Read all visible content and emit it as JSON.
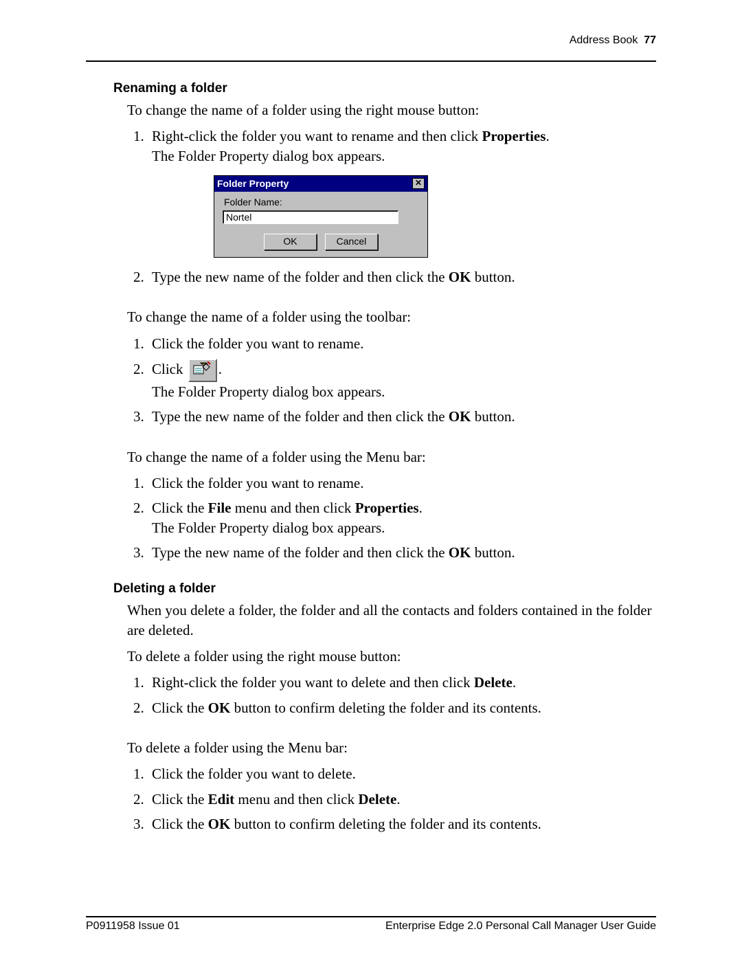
{
  "header": {
    "section": "Address Book",
    "page_no": "77"
  },
  "s1": {
    "heading": "Renaming a folder",
    "intro_rc": "To change the name of a folder using the right mouse button:",
    "rc_step1_pre": "Right-click the folder you want to rename and then click ",
    "rc_step1_bold": "Properties",
    "rc_step1_post": ".",
    "rc_step1_line2": "The Folder Property dialog box appears.",
    "rc_step2_pre": "Type the new name of the folder and then click the ",
    "rc_step2_bold": "OK",
    "rc_step2_post": " button.",
    "intro_tb": "To change the name of a folder using the toolbar:",
    "tb_step1": "Click the folder you want to rename.",
    "tb_step2_pre": "Click ",
    "tb_step2_post": ".",
    "tb_step2_line2": "The Folder Property dialog box appears.",
    "tb_step3_pre": "Type the new name of the folder and then click the ",
    "tb_step3_bold": "OK",
    "tb_step3_post": " button.",
    "intro_mb": "To change the name of a folder using the Menu bar:",
    "mb_step1": "Click the folder you want to rename.",
    "mb_step2_a": "Click the ",
    "mb_step2_file": "File",
    "mb_step2_b": " menu and then click ",
    "mb_step2_props": "Properties",
    "mb_step2_c": ".",
    "mb_step2_line2": "The Folder Property dialog box appears.",
    "mb_step3_pre": "Type the new name of the folder and then click the ",
    "mb_step3_bold": "OK",
    "mb_step3_post": " button."
  },
  "dialog": {
    "title": "Folder Property",
    "label": "Folder Name:",
    "value": "Nortel",
    "ok": "OK",
    "cancel": "Cancel",
    "close_glyph": "✕"
  },
  "s2": {
    "heading": "Deleting a folder",
    "intro": "When you delete a folder, the folder and all the contacts and folders contained in the folder are deleted.",
    "intro_rc": "To delete a folder using the right mouse button:",
    "rc_step1_pre": "Right-click the folder you want to delete and then click ",
    "rc_step1_bold": "Delete",
    "rc_step1_post": ".",
    "rc_step2_a": "Click the ",
    "rc_step2_ok": "OK",
    "rc_step2_b": " button to confirm deleting the folder and its contents.",
    "intro_mb": "To delete a folder using the Menu bar:",
    "mb_step1": "Click the folder you want to delete.",
    "mb_step2_a": "Click the ",
    "mb_step2_edit": "Edit",
    "mb_step2_b": " menu and then click ",
    "mb_step2_del": "Delete",
    "mb_step2_c": ".",
    "mb_step3_a": "Click the ",
    "mb_step3_ok": "OK",
    "mb_step3_b": " button to confirm deleting the folder and its contents."
  },
  "footer": {
    "left": "P0911958 Issue 01",
    "right": "Enterprise Edge 2.0 Personal Call Manager User Guide"
  }
}
